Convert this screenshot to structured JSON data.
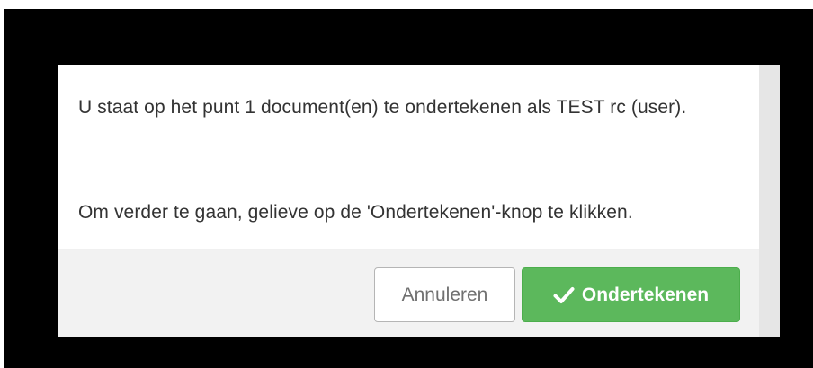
{
  "dialog": {
    "message_1": "U staat op het punt 1 document(en) te ondertekenen als TEST rc (user).",
    "message_2": "Om verder te gaan, gelieve op de 'Ondertekenen'-knop te klikken.",
    "cancel_label": "Annuleren",
    "sign_label": "Ondertekenen",
    "sign_icon": "check-icon",
    "colors": {
      "primary": "#5cb85c",
      "text": "#333333",
      "footer": "#f2f2f2"
    }
  }
}
